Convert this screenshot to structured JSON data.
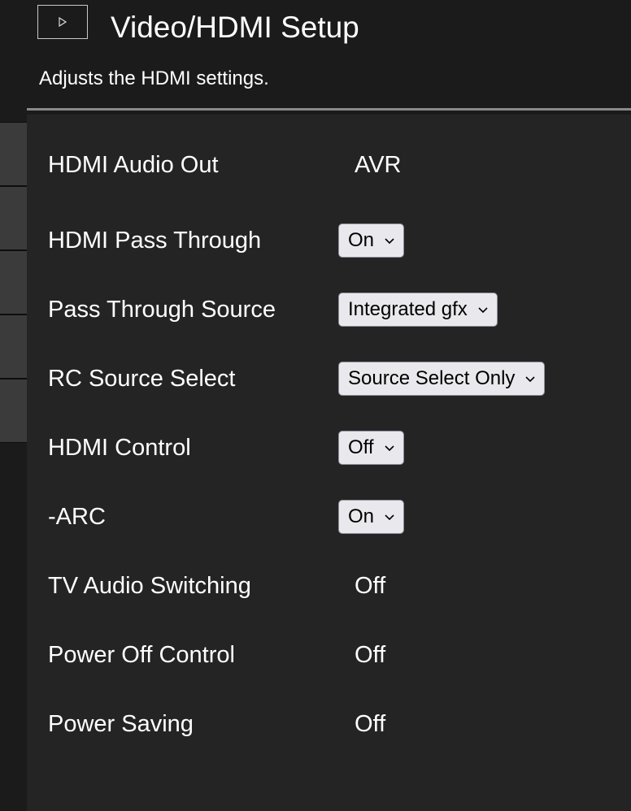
{
  "header": {
    "title": "Video/HDMI Setup",
    "description": "Adjusts the HDMI settings.",
    "icon": "play-icon"
  },
  "settings": [
    {
      "label": "HDMI Audio Out",
      "value": "AVR",
      "control": "static"
    },
    {
      "label": "HDMI Pass Through",
      "value": "On",
      "control": "select"
    },
    {
      "label": "Pass Through Source",
      "value": "Integrated gfx",
      "control": "select"
    },
    {
      "label": "RC Source Select",
      "value": "Source Select Only",
      "control": "select"
    },
    {
      "label": "HDMI Control",
      "value": "Off",
      "control": "select"
    },
    {
      "label": "-ARC",
      "value": "On",
      "control": "select"
    },
    {
      "label": "TV Audio Switching",
      "value": "Off",
      "control": "static"
    },
    {
      "label": "Power Off Control",
      "value": "Off",
      "control": "static"
    },
    {
      "label": "Power Saving",
      "value": "Off",
      "control": "static"
    }
  ],
  "colors": {
    "background": "#1b1b1b",
    "panel": "#242424",
    "text": "#ffffff",
    "select_background": "#e9e9ed"
  }
}
